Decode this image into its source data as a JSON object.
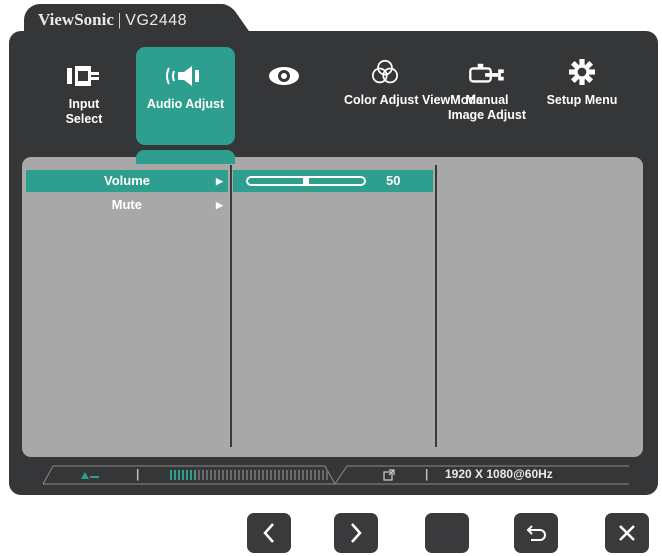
{
  "brand": {
    "name": "ViewSonic",
    "separator": "|",
    "model": "VG2448"
  },
  "tabs": [
    {
      "label": "Input Select",
      "icon": "input-plug-icon"
    },
    {
      "label": "Audio Adjust",
      "icon": "speaker-icon",
      "active": true
    },
    {
      "label": "",
      "icon": "eye-icon"
    },
    {
      "label": "Color Adjust",
      "icon": "color-circles-icon"
    },
    {
      "label": "ViewMode",
      "icon": "tools-icon"
    },
    {
      "label": "Manual Image Adjust",
      "icon": ""
    },
    {
      "label": "Setup Menu",
      "icon": "gear-icon"
    }
  ],
  "menu": {
    "items": [
      {
        "label": "Volume",
        "arrow": "▶",
        "selected": true
      },
      {
        "label": "Mute",
        "arrow": "▶",
        "selected": false
      }
    ],
    "volume": {
      "value": "50",
      "level": 0.5
    }
  },
  "status_bar": {
    "input_icon": "input-signal-icon",
    "separator": "|",
    "level_bars": {
      "total": 40,
      "on": 7
    },
    "link_icon": "external-link-icon",
    "resolution": "1920 X 1080@60Hz"
  },
  "keys": [
    {
      "name": "left-key",
      "icon": "chevron-left-icon"
    },
    {
      "name": "right-key",
      "icon": "chevron-right-icon"
    },
    {
      "name": "select-key",
      "icon": ""
    },
    {
      "name": "back-key",
      "icon": "return-icon"
    },
    {
      "name": "exit-key",
      "icon": "close-icon"
    }
  ],
  "colors": {
    "accent": "#2e9e8f",
    "bezel": "#353638",
    "panel": "#a8a8a8",
    "text": "#ffffff"
  }
}
